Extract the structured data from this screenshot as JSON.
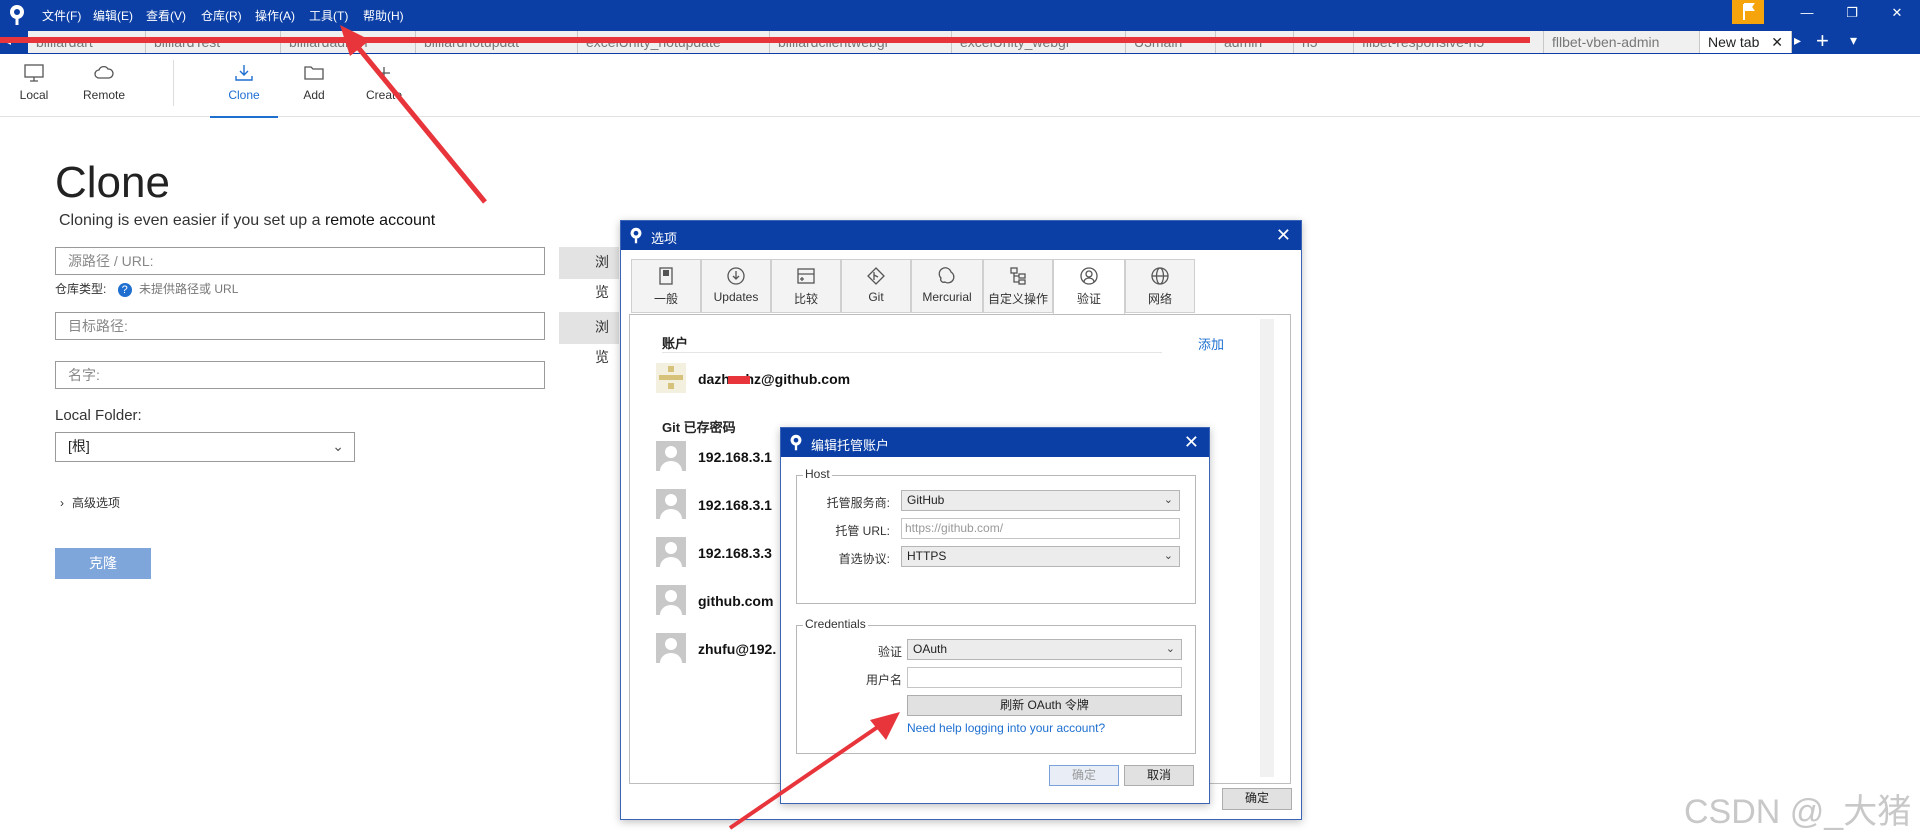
{
  "menu": [
    "文件(F)",
    "编辑(E)",
    "查看(V)",
    "仓库(R)",
    "操作(A)",
    "工具(T)",
    "帮助(H)"
  ],
  "window_controls": {
    "minimize": "—",
    "restore": "❐",
    "close": "✕"
  },
  "tabs": [
    "billiardart",
    "billiardTest",
    "billiardadmin",
    "billiardhotupdat",
    "excelUnity_hotupdate",
    "billiardclientwebgl",
    "excelUnity_webgl",
    "U3main",
    "admin",
    "h5",
    "fllbet-responsive-h5",
    "fllbet-vben-admin"
  ],
  "active_tab": "New tab",
  "tabbar_controls": {
    "left": "◂",
    "right": "▸",
    "add": "+",
    "more": "▾"
  },
  "toolbar": {
    "local": "Local",
    "remote": "Remote",
    "clone": "Clone",
    "add": "Add",
    "create": "Create"
  },
  "clone_page": {
    "title": "Clone",
    "subtitle_prefix": "Cloning is even easier if you set up a ",
    "subtitle_link": "remote account",
    "source_placeholder": "源路径 / URL:",
    "browse": "浏览",
    "repo_type_label": "仓库类型:",
    "repo_type_info": "?",
    "repo_type_value": "未提供路径或 URL",
    "dest_placeholder": "目标路径:",
    "name_placeholder": "名字:",
    "local_folder_label": "Local Folder:",
    "local_folder_value": "[根]",
    "advanced": "高级选项",
    "clone_button": "克隆"
  },
  "options_dialog": {
    "title": "选项",
    "close": "✕",
    "tabs": [
      "一般",
      "Updates",
      "比较",
      "Git",
      "Mercurial",
      "自定义操作",
      "验证",
      "网络"
    ],
    "selected_tab": "验证",
    "accounts_header": "账户",
    "add_link": "添加",
    "accounts": [
      {
        "name": "dazhuzhz@github.com"
      }
    ],
    "git_passwords_header": "Git 已存密码",
    "saved": [
      "192.168.3.1",
      "192.168.3.1",
      "192.168.3.3",
      "github.com",
      "zhufu@192."
    ],
    "ok_button": "确定"
  },
  "edit_dialog": {
    "title": "编辑托管账户",
    "close": "✕",
    "host_group": "Host",
    "provider_label": "托管服务商:",
    "provider_value": "GitHub",
    "url_label": "托管 URL:",
    "url_placeholder": "https://github.com/",
    "protocol_label": "首选协议:",
    "protocol_value": "HTTPS",
    "cred_group": "Credentials",
    "auth_label": "验证",
    "auth_value": "OAuth",
    "user_label": "用户名",
    "refresh_button": "刷新 OAuth 令牌",
    "help_link": "Need help logging into your account?",
    "ok_button": "确定",
    "cancel_button": "取消"
  },
  "watermark": "CSDN @_大猪",
  "colors": {
    "brand": "#0b3fa5",
    "accent": "#1e6fd0",
    "annotation": "#e8353b",
    "flag": "#f5a40c"
  }
}
